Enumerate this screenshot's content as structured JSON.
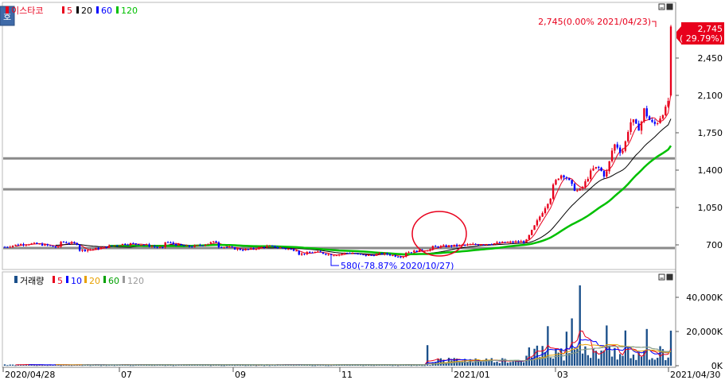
{
  "side_tab": "호",
  "price_panel": {
    "legend": {
      "name": "이스타코",
      "ma": [
        {
          "label": "5",
          "color": "#e8001c"
        },
        {
          "label": "20",
          "color": "#000000"
        },
        {
          "label": "60",
          "color": "#0000ff"
        },
        {
          "label": "120",
          "color": "#00c000"
        }
      ]
    },
    "y_axis": {
      "min": 500,
      "max": 2850,
      "ticks": [
        "2,450",
        "2,100",
        "1,750",
        "1,400",
        "1,050",
        "700"
      ],
      "tick_values": [
        2450,
        2100,
        1750,
        1400,
        1050,
        700
      ]
    },
    "last_price": {
      "value": "2,745",
      "change": "( 29.79%)"
    },
    "high_annotation": "2,745(0.00% 2021/04/23)",
    "low_annotation": "580(-78.87% 2020/10/27)",
    "horizontal_lines": [
      1510,
      1220,
      670
    ]
  },
  "volume_panel": {
    "legend": {
      "name": "거래량",
      "ma": [
        {
          "label": "5",
          "color": "#e8001c"
        },
        {
          "label": "10",
          "color": "#0000ff"
        },
        {
          "label": "20",
          "color": "#e8a000"
        },
        {
          "label": "60",
          "color": "#00a000"
        },
        {
          "label": "120",
          "color": "#9a9a9a"
        }
      ]
    },
    "y_axis": {
      "min": 0,
      "max": 50000,
      "ticks": [
        "40,000K",
        "20,000K",
        "0K"
      ],
      "tick_values": [
        40000,
        20000,
        0
      ]
    }
  },
  "x_axis": {
    "labels": [
      "2020/04/28",
      "07",
      "09",
      "11",
      "2021/01",
      "03",
      "2021/04/30"
    ]
  },
  "colors": {
    "up": "#e8001c",
    "down": "#0000ff",
    "ma5": "#e8001c",
    "ma20": "#000000",
    "ma60": "#0000ff",
    "ma120": "#00c000",
    "volume": "#1a4f8a",
    "grid": "#c0c0c0"
  }
}
